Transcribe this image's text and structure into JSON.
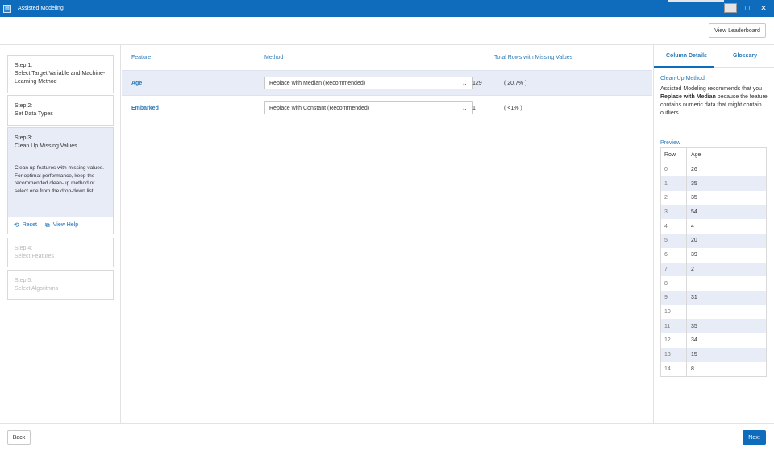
{
  "window": {
    "title": "Assisted Modeling",
    "minimize_glyph": "_",
    "maximize_glyph": "□",
    "close_glyph": "✕"
  },
  "toolbar": {
    "leaderboard_label": "View Leaderboard"
  },
  "steps": [
    {
      "label": "Step 1:",
      "title": "Select Target Variable and Machine-Learning Method",
      "state": "completed"
    },
    {
      "label": "Step 2:",
      "title": "Set Data Types",
      "state": "completed"
    },
    {
      "label": "Step 3:",
      "title": "Clean Up Missing Values",
      "state": "active",
      "description": "Clean up features with missing values. For optimal performance, keep the recommended clean-up method or select one from the drop-down list."
    },
    {
      "label": "Step 4:",
      "title": "Select Features",
      "state": "disabled"
    },
    {
      "label": "Step 5:",
      "title": "Select Algorithms",
      "state": "disabled"
    }
  ],
  "step_actions": {
    "reset_label": "Reset",
    "help_label": "View Help"
  },
  "table": {
    "columns": {
      "feature": "Feature",
      "method": "Method",
      "missing": "Total Rows with Missing Values"
    },
    "rows": [
      {
        "feature": "Age",
        "method": "Replace with Median (Recommended)",
        "count": "129",
        "pct": "( 20.7% )"
      },
      {
        "feature": "Embarked",
        "method": "Replace with Constant (Recommended)",
        "count": "1",
        "pct": "( <1% )"
      }
    ]
  },
  "right_panel": {
    "tabs": {
      "details": "Column Details",
      "glossary": "Glossary"
    },
    "section_title": "Clean-Up Method",
    "text_before": "Assisted Modeling recommends that you ",
    "text_bold": "Replace with Median",
    "text_after": " because the feature contains numeric data that might contain outliers.",
    "preview_title": "Preview",
    "preview_columns": {
      "row": "Row",
      "value": "Age"
    },
    "preview_rows": [
      {
        "row": "0",
        "value": "26"
      },
      {
        "row": "1",
        "value": "35"
      },
      {
        "row": "2",
        "value": "35"
      },
      {
        "row": "3",
        "value": "54"
      },
      {
        "row": "4",
        "value": "4"
      },
      {
        "row": "5",
        "value": "20"
      },
      {
        "row": "6",
        "value": "39"
      },
      {
        "row": "7",
        "value": "2"
      },
      {
        "row": "8",
        "value": ""
      },
      {
        "row": "9",
        "value": "31"
      },
      {
        "row": "10",
        "value": ""
      },
      {
        "row": "11",
        "value": "35"
      },
      {
        "row": "12",
        "value": "34"
      },
      {
        "row": "13",
        "value": "15"
      },
      {
        "row": "14",
        "value": "8"
      }
    ]
  },
  "footer": {
    "back_label": "Back",
    "next_label": "Next"
  },
  "colors": {
    "accent": "#0f6cbd",
    "highlight_row": "#e8ecf7",
    "link": "#2a7ab8"
  }
}
